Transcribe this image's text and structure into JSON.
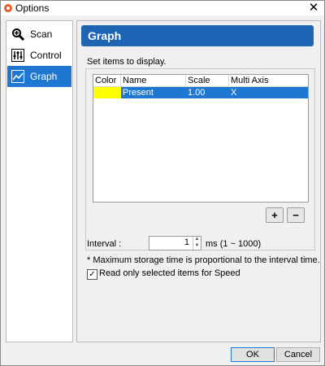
{
  "window": {
    "title": "Options",
    "close_glyph": "✕"
  },
  "sidebar": {
    "items": [
      {
        "label": "Scan",
        "icon": "magnifier-icon"
      },
      {
        "label": "Control",
        "icon": "sliders-icon"
      },
      {
        "label": "Graph",
        "icon": "chart-icon",
        "selected": true
      }
    ]
  },
  "header": {
    "title": "Graph"
  },
  "content": {
    "instructions": "Set items to display.",
    "table": {
      "columns": [
        "Color",
        "Name",
        "Scale",
        "Multi Axis"
      ],
      "rows": [
        {
          "color": "#ffff00",
          "name": "Present Position",
          "scale": "1.00",
          "multi_axis": "X"
        }
      ]
    },
    "add_label": "+",
    "remove_label": "−",
    "interval": {
      "label": "Interval :",
      "value": "1",
      "unit": "ms (1 ~ 1000)"
    },
    "note": "* Maximum storage time is proportional to the interval time.",
    "read_only_checkbox": {
      "label": "Read only selected items for Speed",
      "checked": true,
      "check_glyph": "✓"
    }
  },
  "buttons": {
    "ok": "OK",
    "cancel": "Cancel"
  },
  "colors": {
    "accent": "#1e78d2",
    "header": "#1e64b4"
  }
}
